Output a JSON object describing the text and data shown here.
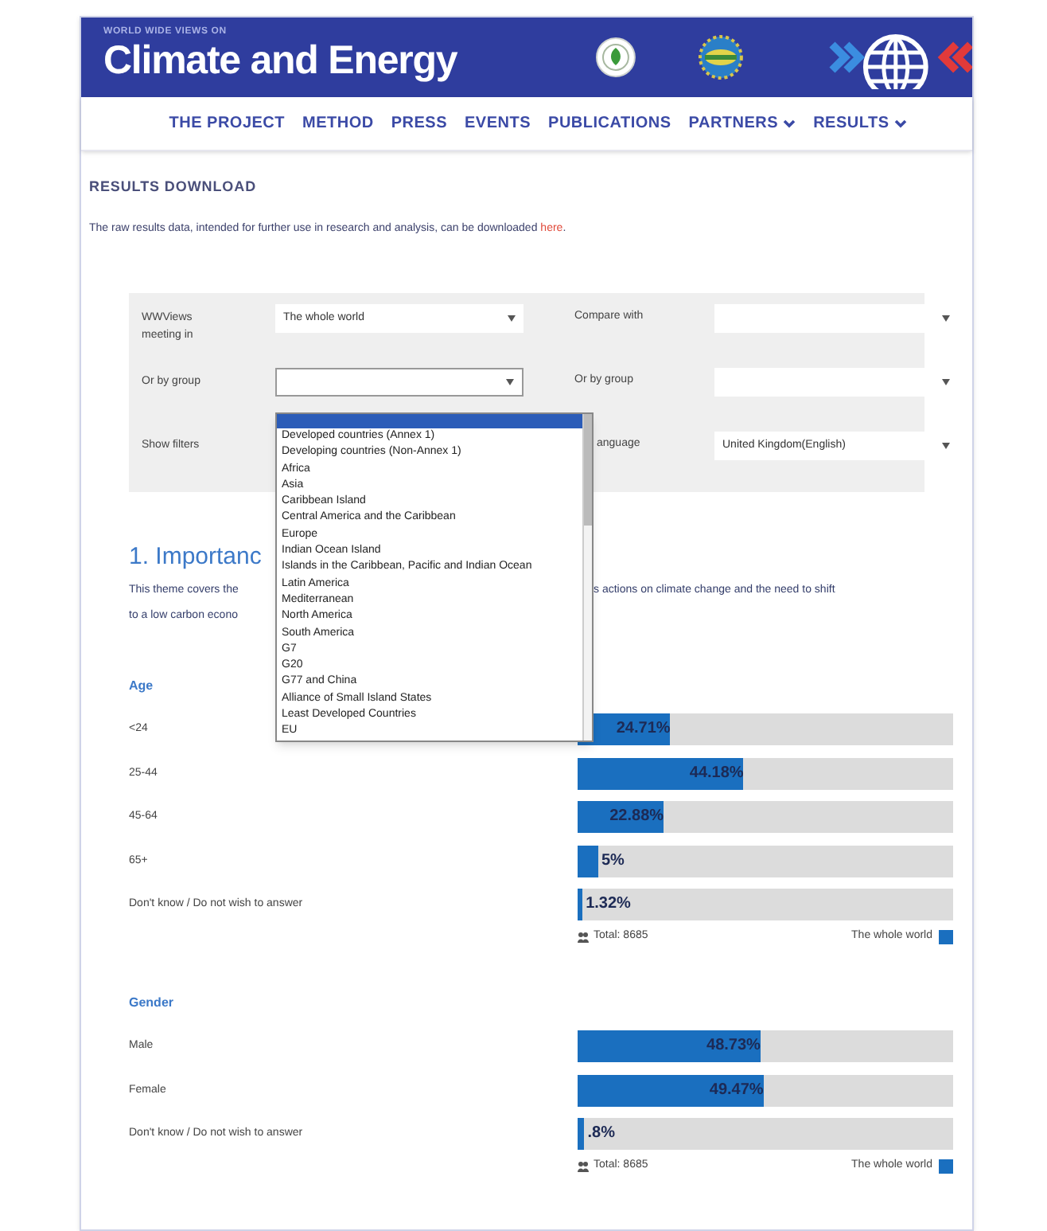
{
  "header": {
    "tagline": "WORLD WIDE VIEWS ON",
    "title": "Climate and Energy"
  },
  "nav": [
    {
      "label": "THE PROJECT",
      "has_menu": false
    },
    {
      "label": "METHOD",
      "has_menu": false
    },
    {
      "label": "PRESS",
      "has_menu": false
    },
    {
      "label": "EVENTS",
      "has_menu": false
    },
    {
      "label": "PUBLICATIONS",
      "has_menu": false
    },
    {
      "label": "PARTNERS",
      "has_menu": true
    },
    {
      "label": "RESULTS",
      "has_menu": true
    }
  ],
  "download": {
    "heading": "RESULTS DOWNLOAD",
    "text": "The raw results data, intended for further use in research and analysis, can be downloaded ",
    "link": "here",
    "end": "."
  },
  "filters": [
    {
      "label": "WWViews meeting in",
      "value": "The whole world",
      "compare_label": "Compare with"
    },
    {
      "label": "Or by group",
      "compare_label": "Or by group"
    },
    {
      "label": "Show filters",
      "compare_label": "anguage",
      "compare_value": "United Kingdom(English)"
    }
  ],
  "group_dropdown": {
    "blank_selected": true,
    "options": [
      "Developed countries (Annex 1)",
      "Developing countries (Non-Annex 1)",
      "Africa",
      "Asia",
      "Caribbean Island",
      "Central America and the Caribbean",
      "Europe",
      "Indian Ocean Island",
      "Islands in the Caribbean, Pacific and Indian Ocean",
      "Latin America",
      "Mediterranean",
      "North America",
      "South America",
      "G7",
      "G20",
      "G77 and China",
      "Alliance of Small Island States",
      "Least Developed Countries",
      "EU"
    ]
  },
  "section": {
    "heading": "1. Importanc",
    "intro_left": "This theme covers the",
    "intro_right": "s actions on climate change and the need to shift",
    "intro_line2": "to a low carbon econo"
  },
  "groups": [
    {
      "title": "Age",
      "rows": [
        {
          "label": "<24",
          "value": "24.71%",
          "level": 0.247
        },
        {
          "label": "25-44",
          "value": "44.18%",
          "level": 0.442
        },
        {
          "label": "45-64",
          "value": "22.88%",
          "level": 0.229
        },
        {
          "label": "65+",
          "value": "5%",
          "level": 0.055
        },
        {
          "label": "Don't know / Do not wish to answer",
          "value": "1.32%",
          "level": 0.013
        }
      ],
      "total": "Total: 8685",
      "legend": "The whole world",
      "color": "#1a6fbf"
    },
    {
      "title": "Gender",
      "rows": [
        {
          "label": "Male",
          "value": "48.73%",
          "level": 0.487
        },
        {
          "label": "Female",
          "value": "49.47%",
          "level": 0.495
        },
        {
          "label": "Don't know / Do not wish to answer",
          "value": ".8%",
          "level": 0.018
        }
      ],
      "total": "Total: 8685",
      "legend": "The whole world",
      "color": "#1a6fbf"
    }
  ]
}
